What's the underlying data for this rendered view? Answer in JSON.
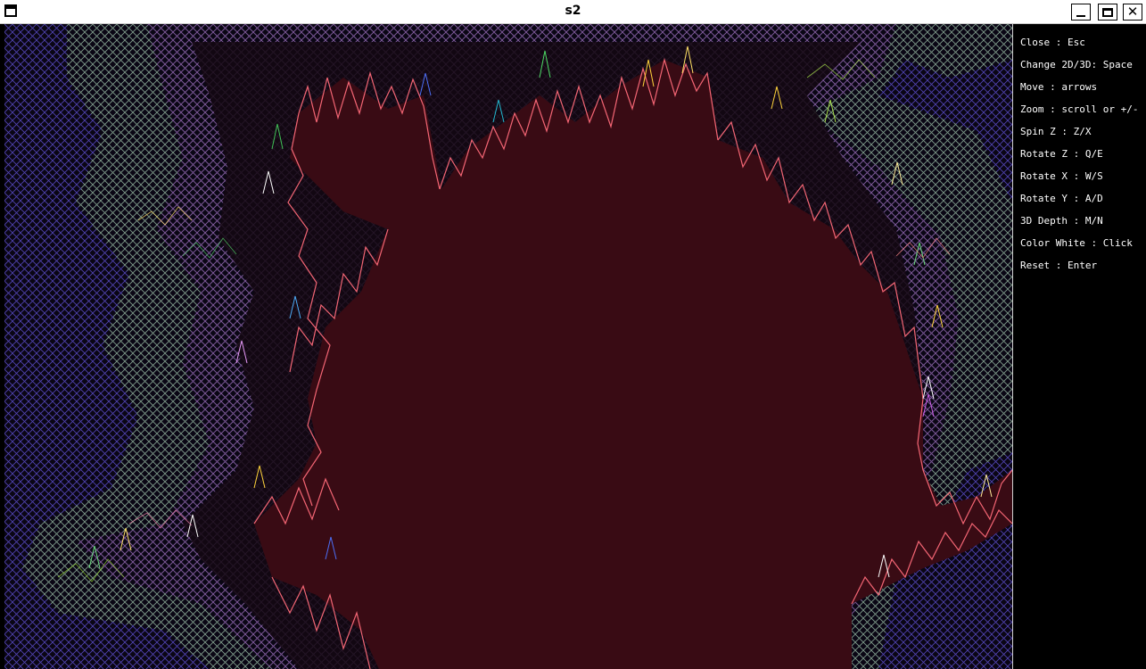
{
  "window": {
    "title": "s2",
    "controls": {
      "minimize": "minimize",
      "maximize": "maximize",
      "close": "✕"
    }
  },
  "help": [
    "Close : Esc",
    "Change 2D/3D: Space",
    "Move : arrows",
    "Zoom : scroll or +/-",
    "Spin Z : Z/X",
    "Rotate Z : Q/E",
    "Rotate X : W/S",
    "Rotate Y : A/D",
    "3D Depth : M/N",
    "Color White : Click",
    "Reset : Enter"
  ],
  "colors": {
    "background": "#000000",
    "interior": "#e8606c",
    "ridge": "#ff6b7a",
    "outer_blue": "#5a4cc8",
    "outer_green": "#8ab86a",
    "outer_purple": "#7a3a9a"
  }
}
